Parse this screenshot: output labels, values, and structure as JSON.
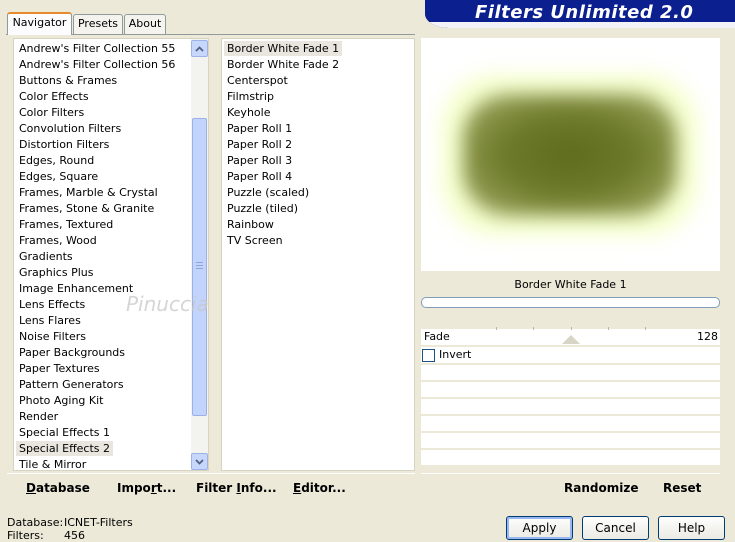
{
  "banner": {
    "title": "Filters Unlimited 2.0"
  },
  "tabs": [
    {
      "label": "Navigator",
      "active": true
    },
    {
      "label": "Presets",
      "active": false
    },
    {
      "label": "About",
      "active": false
    }
  ],
  "categories": {
    "selected": "Special Effects 2",
    "items": [
      "Andrew's Filter Collection 55",
      "Andrew's Filter Collection 56",
      "Buttons & Frames",
      "Color Effects",
      "Color Filters",
      "Convolution Filters",
      "Distortion Filters",
      "Edges, Round",
      "Edges, Square",
      "Frames, Marble & Crystal",
      "Frames, Stone & Granite",
      "Frames, Textured",
      "Frames, Wood",
      "Gradients",
      "Graphics Plus",
      "Image Enhancement",
      "Lens Effects",
      "Lens Flares",
      "Noise Filters",
      "Paper Backgrounds",
      "Paper Textures",
      "Pattern Generators",
      "Photo Aging Kit",
      "Render",
      "Special Effects 1",
      "Special Effects 2",
      "Tile & Mirror"
    ]
  },
  "filters": {
    "selected": "Border White Fade 1",
    "items": [
      "Border White Fade 1",
      "Border White Fade 2",
      "Centerspot",
      "Filmstrip",
      "Keyhole",
      "Paper Roll 1",
      "Paper Roll 2",
      "Paper Roll 3",
      "Paper Roll 4",
      "Puzzle (scaled)",
      "Puzzle (tiled)",
      "Rainbow",
      "TV Screen"
    ]
  },
  "preview": {
    "filter_name": "Border White Fade 1",
    "params": [
      {
        "label": "Fade",
        "value": "128",
        "fraction": 0.5
      }
    ],
    "invert_label": "Invert",
    "invert_checked": false
  },
  "toolbar": {
    "database_pre": "",
    "database_u": "D",
    "database_post": "atabase",
    "import_pre": "Impo",
    "import_u": "r",
    "import_post": "t...",
    "filterinfo_pre": "Filter ",
    "filterinfo_u": "I",
    "filterinfo_post": "nfo...",
    "editor_pre": "",
    "editor_u": "E",
    "editor_post": "ditor...",
    "randomize": "Randomize",
    "reset": "Reset"
  },
  "status": {
    "database_label": "Database:",
    "database_value": "ICNET-Filters",
    "filters_label": "Filters:",
    "filters_value": "456"
  },
  "buttons": {
    "apply": "Apply",
    "cancel": "Cancel",
    "help": "Help"
  },
  "watermark": "Pinuccia",
  "colors": {
    "banner": "#0b1f8f",
    "selection": "#e8e6de",
    "tab_highlight": "#e68b2c"
  }
}
